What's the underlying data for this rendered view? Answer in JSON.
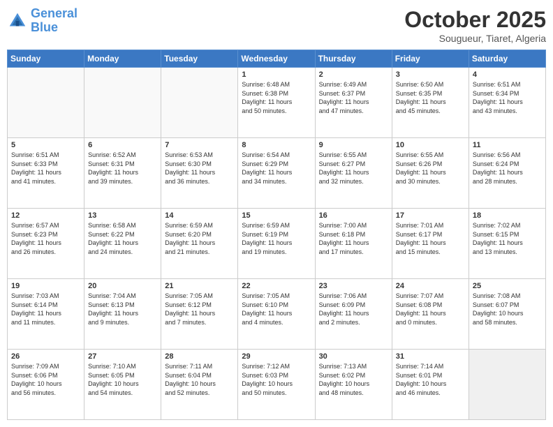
{
  "header": {
    "logo_line1": "General",
    "logo_line2": "Blue",
    "title": "October 2025",
    "subtitle": "Sougueur, Tiaret, Algeria"
  },
  "weekdays": [
    "Sunday",
    "Monday",
    "Tuesday",
    "Wednesday",
    "Thursday",
    "Friday",
    "Saturday"
  ],
  "weeks": [
    [
      {
        "day": "",
        "info": ""
      },
      {
        "day": "",
        "info": ""
      },
      {
        "day": "",
        "info": ""
      },
      {
        "day": "1",
        "info": "Sunrise: 6:48 AM\nSunset: 6:38 PM\nDaylight: 11 hours\nand 50 minutes."
      },
      {
        "day": "2",
        "info": "Sunrise: 6:49 AM\nSunset: 6:37 PM\nDaylight: 11 hours\nand 47 minutes."
      },
      {
        "day": "3",
        "info": "Sunrise: 6:50 AM\nSunset: 6:35 PM\nDaylight: 11 hours\nand 45 minutes."
      },
      {
        "day": "4",
        "info": "Sunrise: 6:51 AM\nSunset: 6:34 PM\nDaylight: 11 hours\nand 43 minutes."
      }
    ],
    [
      {
        "day": "5",
        "info": "Sunrise: 6:51 AM\nSunset: 6:33 PM\nDaylight: 11 hours\nand 41 minutes."
      },
      {
        "day": "6",
        "info": "Sunrise: 6:52 AM\nSunset: 6:31 PM\nDaylight: 11 hours\nand 39 minutes."
      },
      {
        "day": "7",
        "info": "Sunrise: 6:53 AM\nSunset: 6:30 PM\nDaylight: 11 hours\nand 36 minutes."
      },
      {
        "day": "8",
        "info": "Sunrise: 6:54 AM\nSunset: 6:29 PM\nDaylight: 11 hours\nand 34 minutes."
      },
      {
        "day": "9",
        "info": "Sunrise: 6:55 AM\nSunset: 6:27 PM\nDaylight: 11 hours\nand 32 minutes."
      },
      {
        "day": "10",
        "info": "Sunrise: 6:55 AM\nSunset: 6:26 PM\nDaylight: 11 hours\nand 30 minutes."
      },
      {
        "day": "11",
        "info": "Sunrise: 6:56 AM\nSunset: 6:24 PM\nDaylight: 11 hours\nand 28 minutes."
      }
    ],
    [
      {
        "day": "12",
        "info": "Sunrise: 6:57 AM\nSunset: 6:23 PM\nDaylight: 11 hours\nand 26 minutes."
      },
      {
        "day": "13",
        "info": "Sunrise: 6:58 AM\nSunset: 6:22 PM\nDaylight: 11 hours\nand 24 minutes."
      },
      {
        "day": "14",
        "info": "Sunrise: 6:59 AM\nSunset: 6:20 PM\nDaylight: 11 hours\nand 21 minutes."
      },
      {
        "day": "15",
        "info": "Sunrise: 6:59 AM\nSunset: 6:19 PM\nDaylight: 11 hours\nand 19 minutes."
      },
      {
        "day": "16",
        "info": "Sunrise: 7:00 AM\nSunset: 6:18 PM\nDaylight: 11 hours\nand 17 minutes."
      },
      {
        "day": "17",
        "info": "Sunrise: 7:01 AM\nSunset: 6:17 PM\nDaylight: 11 hours\nand 15 minutes."
      },
      {
        "day": "18",
        "info": "Sunrise: 7:02 AM\nSunset: 6:15 PM\nDaylight: 11 hours\nand 13 minutes."
      }
    ],
    [
      {
        "day": "19",
        "info": "Sunrise: 7:03 AM\nSunset: 6:14 PM\nDaylight: 11 hours\nand 11 minutes."
      },
      {
        "day": "20",
        "info": "Sunrise: 7:04 AM\nSunset: 6:13 PM\nDaylight: 11 hours\nand 9 minutes."
      },
      {
        "day": "21",
        "info": "Sunrise: 7:05 AM\nSunset: 6:12 PM\nDaylight: 11 hours\nand 7 minutes."
      },
      {
        "day": "22",
        "info": "Sunrise: 7:05 AM\nSunset: 6:10 PM\nDaylight: 11 hours\nand 4 minutes."
      },
      {
        "day": "23",
        "info": "Sunrise: 7:06 AM\nSunset: 6:09 PM\nDaylight: 11 hours\nand 2 minutes."
      },
      {
        "day": "24",
        "info": "Sunrise: 7:07 AM\nSunset: 6:08 PM\nDaylight: 11 hours\nand 0 minutes."
      },
      {
        "day": "25",
        "info": "Sunrise: 7:08 AM\nSunset: 6:07 PM\nDaylight: 10 hours\nand 58 minutes."
      }
    ],
    [
      {
        "day": "26",
        "info": "Sunrise: 7:09 AM\nSunset: 6:06 PM\nDaylight: 10 hours\nand 56 minutes."
      },
      {
        "day": "27",
        "info": "Sunrise: 7:10 AM\nSunset: 6:05 PM\nDaylight: 10 hours\nand 54 minutes."
      },
      {
        "day": "28",
        "info": "Sunrise: 7:11 AM\nSunset: 6:04 PM\nDaylight: 10 hours\nand 52 minutes."
      },
      {
        "day": "29",
        "info": "Sunrise: 7:12 AM\nSunset: 6:03 PM\nDaylight: 10 hours\nand 50 minutes."
      },
      {
        "day": "30",
        "info": "Sunrise: 7:13 AM\nSunset: 6:02 PM\nDaylight: 10 hours\nand 48 minutes."
      },
      {
        "day": "31",
        "info": "Sunrise: 7:14 AM\nSunset: 6:01 PM\nDaylight: 10 hours\nand 46 minutes."
      },
      {
        "day": "",
        "info": ""
      }
    ]
  ]
}
